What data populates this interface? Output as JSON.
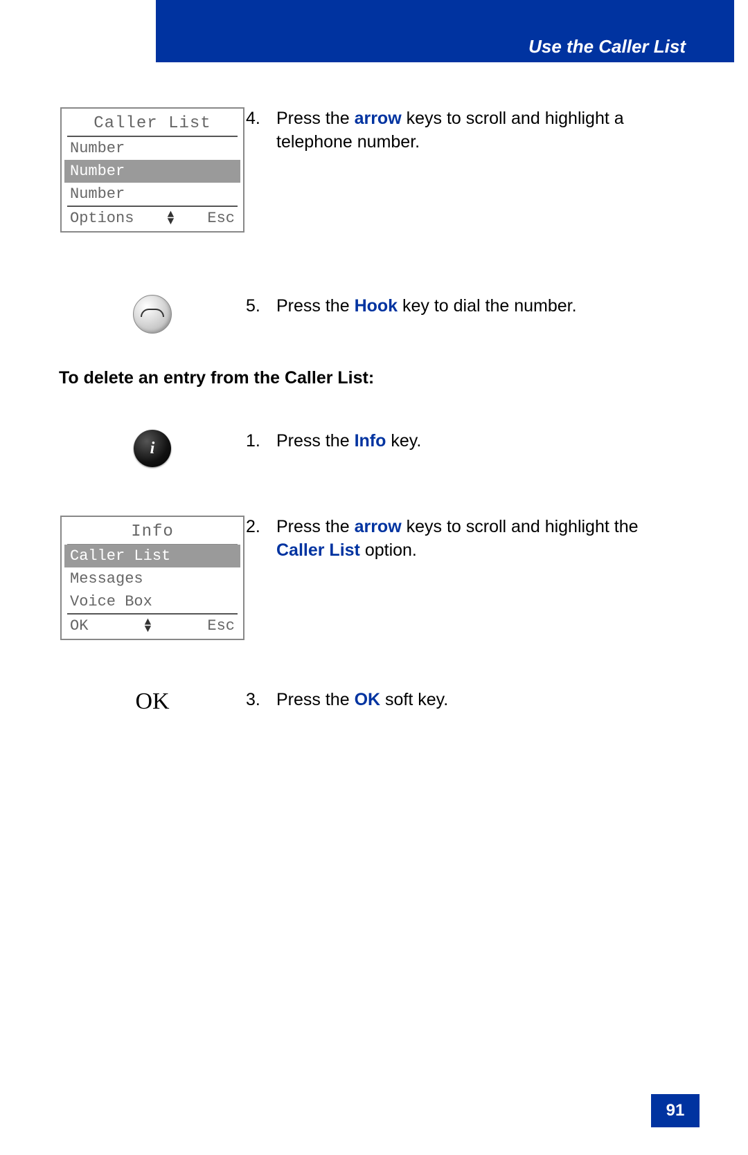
{
  "header": {
    "title": "Use the Caller List"
  },
  "page_number": "91",
  "screen1": {
    "title": "Caller List",
    "items": [
      "Number",
      "Number",
      "Number"
    ],
    "selected_index": 1,
    "softkey_left": "Options",
    "softkey_right": "Esc"
  },
  "step4": {
    "num": "4.",
    "pre": "Press the ",
    "kw": "arrow",
    "post": " keys to scroll and highlight a telephone number."
  },
  "step5": {
    "num": "5.",
    "pre": "Press the ",
    "kw": "Hook",
    "post": " key to dial the number."
  },
  "section_heading": "To delete an entry from the Caller List:",
  "stepD1": {
    "num": "1.",
    "pre": "Press the ",
    "kw": "Info",
    "post": " key."
  },
  "screen2": {
    "title": "Info",
    "items": [
      "Caller List",
      "Messages",
      "Voice Box"
    ],
    "selected_index": 0,
    "softkey_left": "OK",
    "softkey_right": "Esc"
  },
  "stepD2": {
    "num": "2.",
    "pre": "Press the ",
    "kw1": "arrow",
    "mid": " keys to scroll and highlight the ",
    "kw2": "Caller List",
    "post": " option."
  },
  "ok_label": "OK",
  "stepD3": {
    "num": "3.",
    "pre": "Press the ",
    "kw": "OK",
    "post": " soft key."
  },
  "info_button_glyph": "i"
}
